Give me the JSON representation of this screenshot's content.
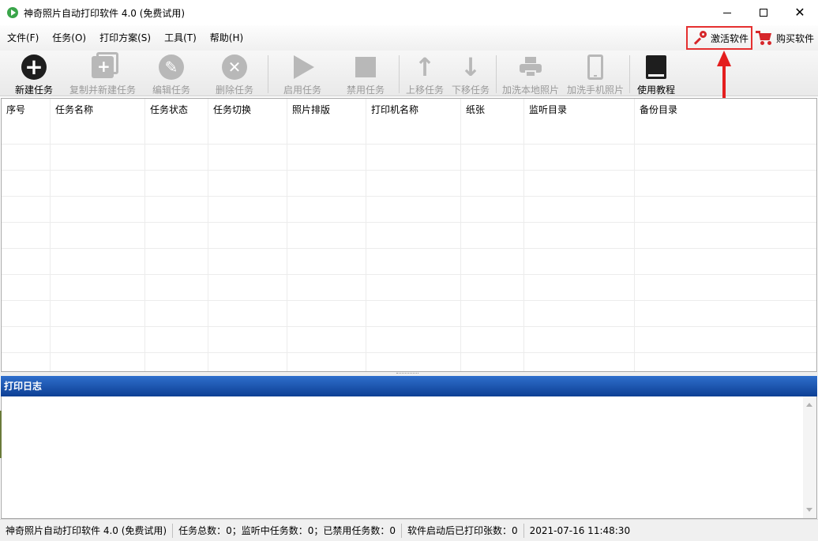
{
  "window": {
    "title": "神奇照片自动打印软件 4.0 (免费试用)",
    "controls": [
      "minimize-icon",
      "maximize-icon",
      "close-icon"
    ]
  },
  "menu": {
    "items": [
      "文件(F)",
      "任务(O)",
      "打印方案(S)",
      "工具(T)",
      "帮助(H)"
    ],
    "activate_label": "激活软件",
    "buy_label": "购买软件"
  },
  "toolbar": {
    "new_task": "新建任务",
    "copy_new_task": "复制并新建任务",
    "edit_task": "编辑任务",
    "delete_task": "删除任务",
    "enable_task": "启用任务",
    "disable_task": "禁用任务",
    "move_up": "上移任务",
    "move_down": "下移任务",
    "add_local_photos": "加洗本地照片",
    "add_phone_photos": "加洗手机照片",
    "tutorial": "使用教程"
  },
  "table": {
    "columns": [
      "序号",
      "任务名称",
      "任务状态",
      "任务切换",
      "照片排版",
      "打印机名称",
      "纸张",
      "监听目录",
      "备份目录"
    ],
    "rows": []
  },
  "log": {
    "title": "打印日志",
    "content": ""
  },
  "status": {
    "app": "神奇照片自动打印软件 4.0 (免费试用)",
    "counts": "任务总数：0；监听中任务数：0；已禁用任务数：0",
    "printed": "软件启动后已打印张数：0",
    "datetime": "2021-07-16 11:48:30"
  },
  "colors": {
    "accent_red": "#e41e1e",
    "log_header_blue": "#1a4fa8",
    "disabled_grey": "#b8b8b8"
  }
}
